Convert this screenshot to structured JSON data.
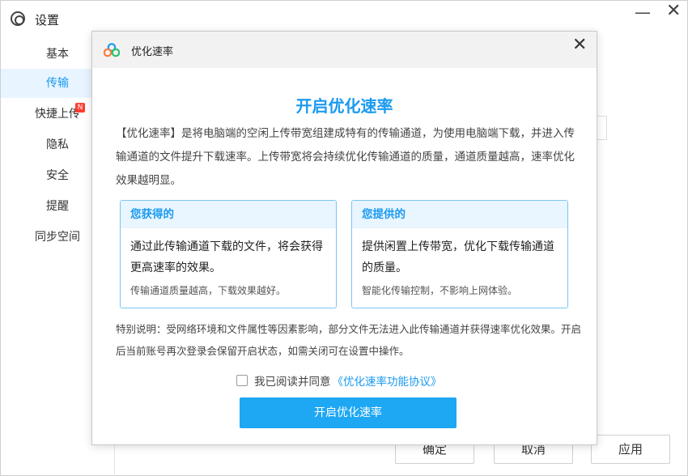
{
  "window": {
    "title": "设置",
    "minimize_glyph": "—",
    "close_glyph": "✕"
  },
  "sidebar": {
    "items": [
      {
        "label": "基本"
      },
      {
        "label": "传输"
      },
      {
        "label": "快捷上传",
        "badge": "N"
      },
      {
        "label": "隐私"
      },
      {
        "label": "安全"
      },
      {
        "label": "提醒"
      },
      {
        "label": "同步空间"
      }
    ],
    "active_index": 1
  },
  "footer": {
    "ok_label": "确定",
    "cancel_label": "取消",
    "apply_label": "应用"
  },
  "modal": {
    "title": "优化速率",
    "close_glyph": "✕",
    "heading": "开启优化速率",
    "description": "【优化速率】是将电脑端的空闲上传带宽组建成特有的传输通道，为使用电脑端下载，并进入传输通道的文件提升下载速率。上传带宽将会持续优化传输通道的质量，通道质量越高，速率优化效果越明显。",
    "cards": [
      {
        "title": "您获得的",
        "main": "通过此传输通道下载的文件，将会获得更高速率的效果。",
        "note": "传输通道质量越高，下载效果越好。"
      },
      {
        "title": "您提供的",
        "main": "提供闲置上传带宽，优化下载传输通道的质量。",
        "note": "智能化传输控制，不影响上网体验。"
      }
    ],
    "notice": "特别说明：受网络环境和文件属性等因素影响，部分文件无法进入此传输通道并获得速率优化效果。开启后当前账号再次登录会保留开启状态，如需关闭可在设置中操作。",
    "agree_text": "我已阅读并同意",
    "agree_link": "《优化速率功能协议》",
    "agree_checked": false,
    "primary_button": "开启优化速率"
  },
  "colors": {
    "accent": "#1a9af0",
    "button": "#1ea7f3",
    "badge": "#ff3b30"
  }
}
